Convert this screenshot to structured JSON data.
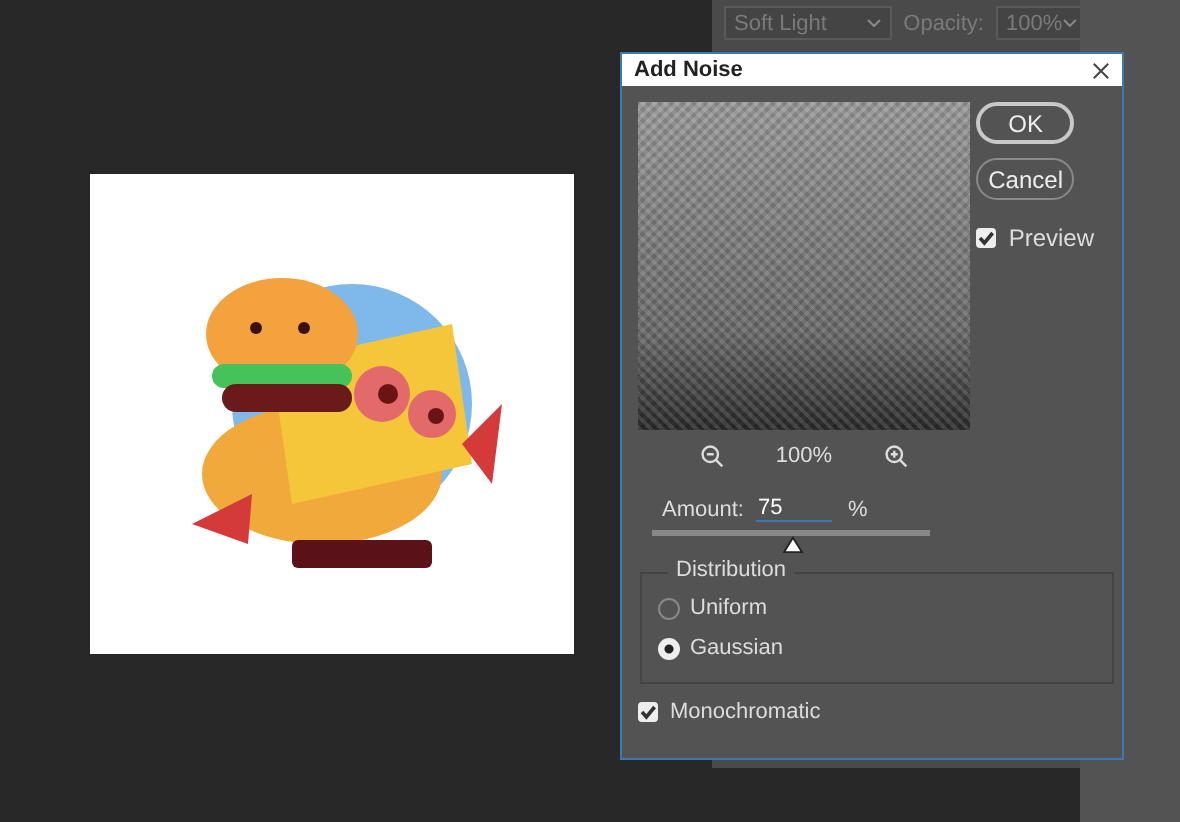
{
  "layers_panel": {
    "blend_mode": "Soft Light",
    "opacity_label": "Opacity:",
    "opacity_value": "100%",
    "disabled": true
  },
  "dialog": {
    "title": "Add Noise",
    "buttons": [
      {
        "label": "OK",
        "default": true
      },
      {
        "label": "Cancel",
        "default": false
      }
    ],
    "preview": {
      "label": "Preview",
      "checked": true
    },
    "zoom": "100%",
    "amount": {
      "label": "Amount:",
      "value": "75",
      "unit": "%",
      "level": 0.5
    },
    "distribution": {
      "title": "Distribution",
      "options": [
        {
          "label": "Uniform",
          "selected": false
        },
        {
          "label": "Gaussian",
          "selected": true
        }
      ]
    },
    "monochromatic": {
      "label": "Monochromatic",
      "checked": true
    }
  }
}
